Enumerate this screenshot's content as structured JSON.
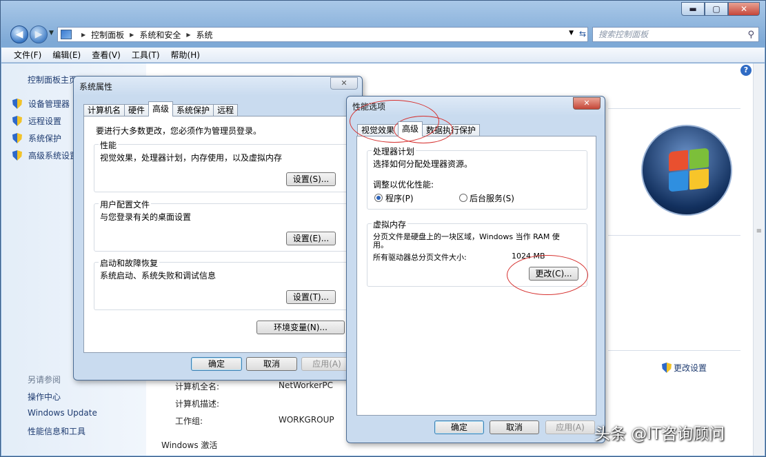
{
  "window": {
    "caption": {
      "minimize": "▬",
      "maximize": "▢",
      "close": "✕"
    }
  },
  "nav": {
    "back": "◀",
    "forward": "▶",
    "breadcrumbs": [
      "控制面板",
      "系统和安全",
      "系统"
    ],
    "search_placeholder": "搜索控制面板"
  },
  "menu": [
    "文件(F)",
    "编辑(E)",
    "查看(V)",
    "工具(T)",
    "帮助(H)"
  ],
  "left_pane": {
    "home": "控制面板主页",
    "items": [
      "设备管理器",
      "远程设置",
      "系统保护",
      "高级系统设置"
    ],
    "see_also_title": "另请参阅",
    "see_also": [
      "操作中心",
      "Windows Update",
      "性能信息和工具"
    ]
  },
  "main": {
    "change_settings": "更改设置",
    "computer_full_name_label": "计算机全名:",
    "computer_full_name": "NetWorkerPC",
    "computer_desc_label": "计算机描述:",
    "workgroup_label": "工作组:",
    "workgroup": "WORKGROUP",
    "activation": "Windows 激活"
  },
  "sys_props": {
    "title": "系统属性",
    "close": "✕",
    "tabs": [
      "计算机名",
      "硬件",
      "高级",
      "系统保护",
      "远程"
    ],
    "admin_note": "要进行大多数更改，您必须作为管理员登录。",
    "performance": {
      "title": "性能",
      "desc": "视觉效果，处理器计划，内存使用，以及虚拟内存",
      "button": "设置(S)..."
    },
    "profiles": {
      "title": "用户配置文件",
      "desc": "与您登录有关的桌面设置",
      "button": "设置(E)..."
    },
    "startup": {
      "title": "启动和故障恢复",
      "desc": "系统启动、系统失败和调试信息",
      "button": "设置(T)..."
    },
    "env_button": "环境变量(N)...",
    "ok": "确定",
    "cancel": "取消",
    "apply": "应用(A)"
  },
  "perf_opts": {
    "title": "性能选项",
    "close": "✕",
    "tabs": [
      "视觉效果",
      "高级",
      "数据执行保护"
    ],
    "scheduling": {
      "title": "处理器计划",
      "desc": "选择如何分配处理器资源。",
      "adjust_label": "调整以优化性能:",
      "option_programs": "程序(P)",
      "option_services": "后台服务(S)"
    },
    "vm": {
      "title": "虚拟内存",
      "desc_line1": "分页文件是硬盘上的一块区域，Windows 当作 RAM 使",
      "desc_line2": "用。",
      "total_label": "所有驱动器总分页文件大小:",
      "total_value": "1024 MB",
      "change_button": "更改(C)..."
    },
    "ok": "确定",
    "cancel": "取消",
    "apply": "应用(A)"
  },
  "watermark": "头条 @IT咨询顾问",
  "colors": {
    "annotation_red": "#d6302e",
    "link_blue": "#1e3b70"
  }
}
